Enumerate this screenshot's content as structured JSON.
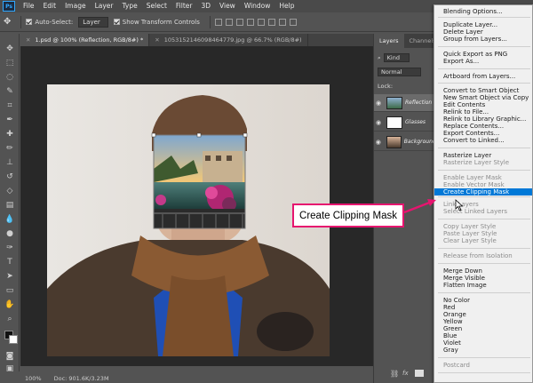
{
  "menubar": {
    "logo": "Ps",
    "items": [
      "File",
      "Edit",
      "Image",
      "Layer",
      "Type",
      "Select",
      "Filter",
      "3D",
      "View",
      "Window",
      "Help"
    ]
  },
  "options": {
    "auto_select_label": "Auto-Select:",
    "auto_select_value": "Layer",
    "transform_label": "Show Transform Controls"
  },
  "tabs": [
    {
      "label": "1.psd @ 100% (Reflection, RGB/8#) *",
      "active": true
    },
    {
      "label": "1053152146098464779.jpg @ 66.7% (RGB/8#)",
      "active": false
    }
  ],
  "status": {
    "zoom": "100%",
    "doc": "Doc: 901.6K/3.23M"
  },
  "panel": {
    "tabs": [
      "Layers",
      "Channels"
    ],
    "kind_label": "Kind",
    "blend_mode": "Normal",
    "lock_label": "Lock:",
    "layers": [
      {
        "name": "Reflection"
      },
      {
        "name": "Glasses"
      },
      {
        "name": "Background"
      }
    ]
  },
  "context_menu": {
    "items": [
      {
        "label": "Blending Options...",
        "state": "normal"
      },
      {
        "label": "Duplicate Layer...",
        "state": "normal"
      },
      {
        "label": "Delete Layer",
        "state": "normal"
      },
      {
        "label": "Group from Layers...",
        "state": "normal"
      },
      {
        "label": "Quick Export as PNG",
        "state": "normal"
      },
      {
        "label": "Export As...",
        "state": "normal"
      },
      {
        "label": "Artboard from Layers...",
        "state": "normal"
      },
      {
        "label": "Convert to Smart Object",
        "state": "normal"
      },
      {
        "label": "New Smart Object via Copy",
        "state": "normal"
      },
      {
        "label": "Edit Contents",
        "state": "normal"
      },
      {
        "label": "Relink to File...",
        "state": "normal"
      },
      {
        "label": "Relink to Library Graphic...",
        "state": "normal"
      },
      {
        "label": "Replace Contents...",
        "state": "normal"
      },
      {
        "label": "Export Contents...",
        "state": "normal"
      },
      {
        "label": "Convert to Linked...",
        "state": "normal"
      },
      {
        "label": "Rasterize Layer",
        "state": "normal"
      },
      {
        "label": "Rasterize Layer Style",
        "state": "disabled"
      },
      {
        "label": "Enable Layer Mask",
        "state": "disabled"
      },
      {
        "label": "Enable Vector Mask",
        "state": "disabled"
      },
      {
        "label": "Create Clipping Mask",
        "state": "highlighted"
      },
      {
        "label": "Link Layers",
        "state": "disabled"
      },
      {
        "label": "Select Linked Layers",
        "state": "disabled"
      },
      {
        "label": "Copy Layer Style",
        "state": "disabled"
      },
      {
        "label": "Paste Layer Style",
        "state": "disabled"
      },
      {
        "label": "Clear Layer Style",
        "state": "disabled"
      },
      {
        "label": "Release from Isolation",
        "state": "disabled"
      },
      {
        "label": "Merge Down",
        "state": "normal"
      },
      {
        "label": "Merge Visible",
        "state": "normal"
      },
      {
        "label": "Flatten Image",
        "state": "normal"
      },
      {
        "label": "No Color",
        "state": "normal"
      },
      {
        "label": "Red",
        "state": "normal"
      },
      {
        "label": "Orange",
        "state": "normal"
      },
      {
        "label": "Yellow",
        "state": "normal"
      },
      {
        "label": "Green",
        "state": "normal"
      },
      {
        "label": "Blue",
        "state": "normal"
      },
      {
        "label": "Violet",
        "state": "normal"
      },
      {
        "label": "Gray",
        "state": "normal"
      },
      {
        "label": "Postcard",
        "state": "disabled"
      }
    ]
  },
  "callout": {
    "label": "Create Clipping Mask",
    "color": "#e6156f"
  },
  "colors": {
    "menu_highlight": "#0078d7",
    "app_bg": "#535353",
    "canvas_bg": "#282828"
  }
}
